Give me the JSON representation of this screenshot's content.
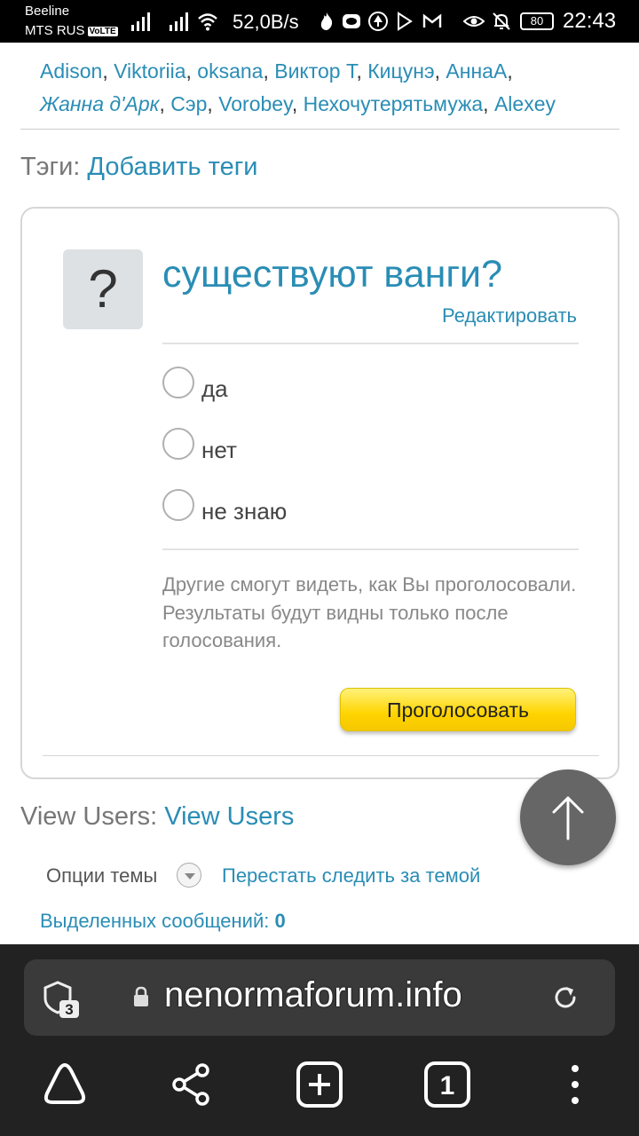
{
  "status_bar": {
    "carrier1": "Beeline",
    "carrier2": "MTS RUS",
    "volte": "VoLTE",
    "speed": "52,0B/s",
    "battery": "80",
    "time": "22:43"
  },
  "participants": {
    "users": [
      "Adison",
      "Viktoriia",
      "oksana",
      "Виктор Т",
      "Кицунэ",
      "АннаА",
      "Жанна д'Арк",
      "Сэр",
      "Vorobey",
      "Нехочутерятьмужа",
      "Alexey"
    ],
    "separator": ", "
  },
  "tags": {
    "label": "Тэги:",
    "add_link": "Добавить теги"
  },
  "poll": {
    "icon": "?",
    "question": "существуют ванги?",
    "edit": "Редактировать",
    "options": [
      "да",
      "нет",
      "не знаю"
    ],
    "note_line1": "Другие смогут видеть, как Вы проголосовали.",
    "note_line2": "Результаты будут видны только после голосования.",
    "vote_button": "Проголосовать"
  },
  "view_users": {
    "label": "View Users:",
    "link": "View Users"
  },
  "thread_tools": {
    "options_label": "Опции темы",
    "unfollow": "Перестать следить за темой",
    "selected_label": "Выделенных сообщений:",
    "selected_count": "0"
  },
  "browser": {
    "shield_count": "3",
    "url": "nenormaforum.info",
    "tabs_count": "1"
  }
}
